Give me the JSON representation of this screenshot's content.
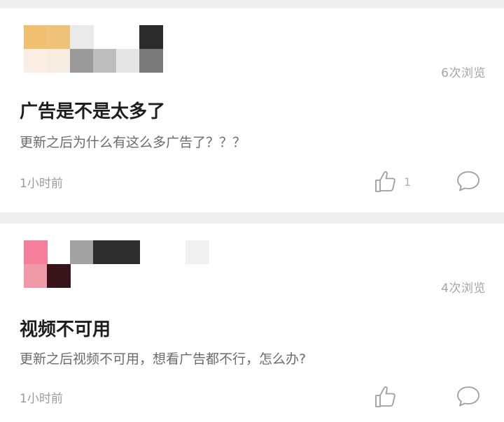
{
  "posts": [
    {
      "views": "6次浏览",
      "title": "广告是不是太多了",
      "body": "更新之后为什么有这么多广告了？？？",
      "time": "1小时前",
      "likes": "1",
      "avatar_colors": {
        "r0": [
          "#f0c070",
          "#efc27a",
          "#eaeaea",
          "#ffffff",
          "#ffffff",
          "#2b2b2b"
        ],
        "r1": [
          "#fbeee4",
          "#f6ecdf",
          "#9a9a9a",
          "#bdbdbd",
          "#e6e6e6",
          "#7b7b7b"
        ]
      }
    },
    {
      "views": "4次浏览",
      "title": "视频不可用",
      "body": "更新之后视频不可用，想看广告都不行，怎么办?",
      "time": "1小时前",
      "likes": "",
      "avatar_colors": {
        "r0": [
          "#f47e9b",
          "#ffffff",
          "#a2a2a2",
          "#2d2d2d",
          "#2d2d2d",
          "#ffffff",
          "#ffffff",
          "#f0f0f0"
        ],
        "r1": [
          "#f09aa8",
          "#371419",
          "#ffffff",
          "#ffffff",
          "#ffffff",
          "#ffffff",
          "#ffffff",
          "#ffffff"
        ]
      }
    }
  ],
  "icons": {
    "like": "thumbs-up-icon",
    "comment": "comment-bubble-icon"
  }
}
